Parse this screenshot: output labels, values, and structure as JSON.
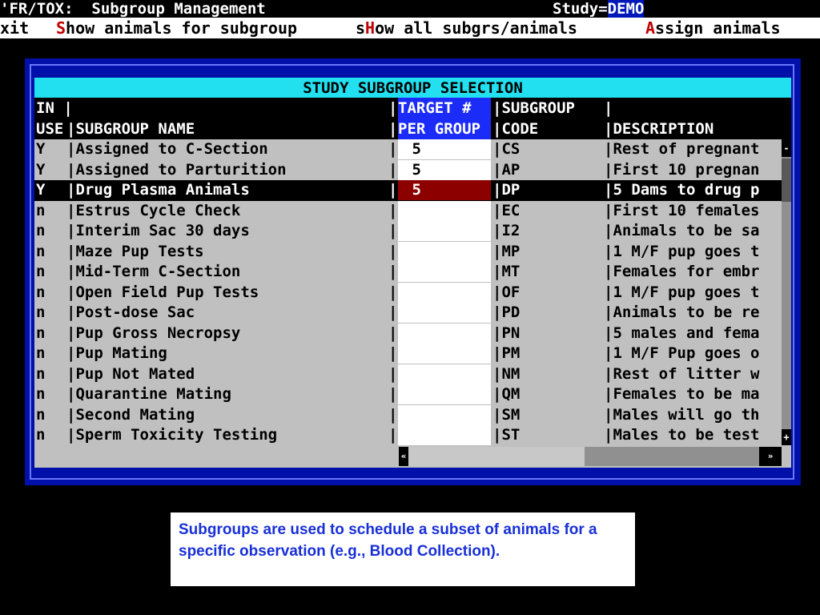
{
  "titlebar": {
    "app_title": "'FR/TOX:  Subgroup Management",
    "study_label": "Study=",
    "study_value": "DEMO"
  },
  "menu": [
    {
      "hot": "",
      "rest": "xit",
      "pre": "",
      "full": "xit"
    },
    {
      "hot": "S",
      "rest": "how animals for subgroup",
      "pre": ""
    },
    {
      "hot": "H",
      "rest": "ow all subgrs/animals",
      "pre": "s"
    },
    {
      "hot": "A",
      "rest": "ssign animals",
      "pre": ""
    }
  ],
  "panel": {
    "title": "STUDY SUBGROUP SELECTION",
    "header1": {
      "c1": "IN |",
      "c3": "|",
      "c4": "TARGET #",
      "c5": "|SUBGROUP",
      "c6": "|"
    },
    "header2": {
      "c1": "USE",
      "c2": "|SUBGROUP NAME",
      "c3": "|",
      "c4": "PER GROUP",
      "c5": "|CODE",
      "c6": "|DESCRIPTION"
    }
  },
  "rows": [
    {
      "in_use": "Y",
      "name": "|Assigned to C-Section",
      "target": " 5",
      "code": "|CS",
      "desc": "|Rest of pregnant"
    },
    {
      "in_use": "Y",
      "name": "|Assigned to Parturition",
      "target": " 5",
      "code": "|AP",
      "desc": "|First 10 pregnan"
    },
    {
      "in_use": "Y",
      "name": "|Drug Plasma Animals",
      "target": " 5",
      "code": "|DP",
      "desc": "|5 Dams to drug p"
    },
    {
      "in_use": "n",
      "name": "|Estrus Cycle Check",
      "target": "",
      "code": "|EC",
      "desc": "|First 10 females"
    },
    {
      "in_use": "n",
      "name": "|Interim Sac 30 days",
      "target": "",
      "code": "|I2",
      "desc": "|Animals to be sa"
    },
    {
      "in_use": "n",
      "name": "|Maze Pup Tests",
      "target": "",
      "code": "|MP",
      "desc": "|1 M/F pup goes t"
    },
    {
      "in_use": "n",
      "name": "|Mid-Term C-Section",
      "target": "",
      "code": "|MT",
      "desc": "|Females for embr"
    },
    {
      "in_use": "n",
      "name": "|Open Field Pup Tests",
      "target": "",
      "code": "|OF",
      "desc": "|1 M/F pup goes t"
    },
    {
      "in_use": "n",
      "name": "|Post-dose Sac",
      "target": "",
      "code": "|PD",
      "desc": "|Animals to be re"
    },
    {
      "in_use": "n",
      "name": "|Pup Gross Necropsy",
      "target": "",
      "code": "|PN",
      "desc": "|5 males and fema"
    },
    {
      "in_use": "n",
      "name": "|Pup Mating",
      "target": "",
      "code": "|PM",
      "desc": "|1 M/F Pup goes o"
    },
    {
      "in_use": "n",
      "name": "|Pup Not Mated",
      "target": "",
      "code": "|NM",
      "desc": "|Rest of litter w"
    },
    {
      "in_use": "n",
      "name": "|Quarantine Mating",
      "target": "",
      "code": "|QM",
      "desc": "|Females to be ma"
    },
    {
      "in_use": "n",
      "name": "|Second Mating",
      "target": "",
      "code": "|SM",
      "desc": "|Males will go th"
    },
    {
      "in_use": "n",
      "name": "|Sperm Toxicity Testing",
      "target": "",
      "code": "|ST",
      "desc": "|Males to be test"
    }
  ],
  "scroll": {
    "left": "«",
    "right": "»",
    "up": "-",
    "down": "+"
  },
  "caption": "Subgroups are used to schedule a subset of animals for a specific observation (e.g., Blood Collection)."
}
